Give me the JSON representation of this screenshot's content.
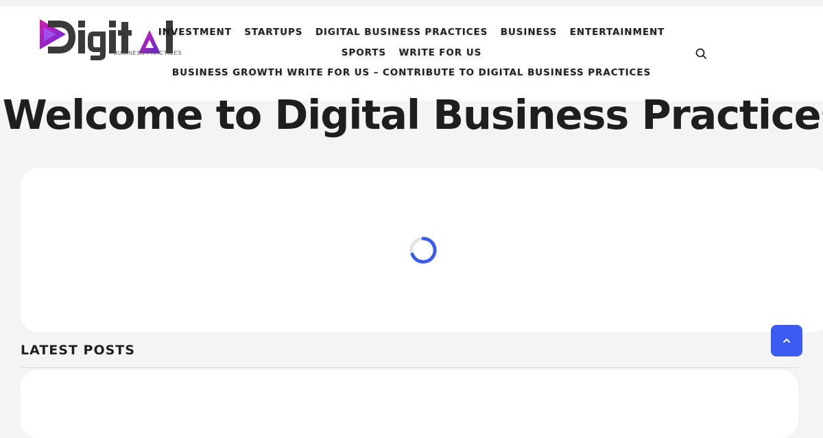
{
  "brand": {
    "logo_word": "Digital",
    "logo_tagline": "BUSINESS PRACTICES",
    "accent_purple": "#7b2ff7",
    "accent_pink": "#d81bb3"
  },
  "nav": {
    "row1": [
      "INVESTMENT",
      "STARTUPS",
      "DIGITAL BUSINESS PRACTICES",
      "BUSINESS",
      "ENTERTAINMENT"
    ],
    "row2": [
      "SPORTS",
      "WRITE FOR US"
    ],
    "row3": [
      "BUSINESS GROWTH WRITE FOR US – CONTRIBUTE TO DIGITAL BUSINESS PRACTICES"
    ],
    "search_icon": "search-icon"
  },
  "hero": {
    "title": "Welcome to Digital Business Practices"
  },
  "slider": {
    "loading_icon": "loading-spinner-icon",
    "spinner_color": "#3b5cf0"
  },
  "latest": {
    "title": "LATEST POSTS"
  },
  "back_to_top": {
    "icon": "chevron-up-icon",
    "color": "#3b5cf0"
  }
}
